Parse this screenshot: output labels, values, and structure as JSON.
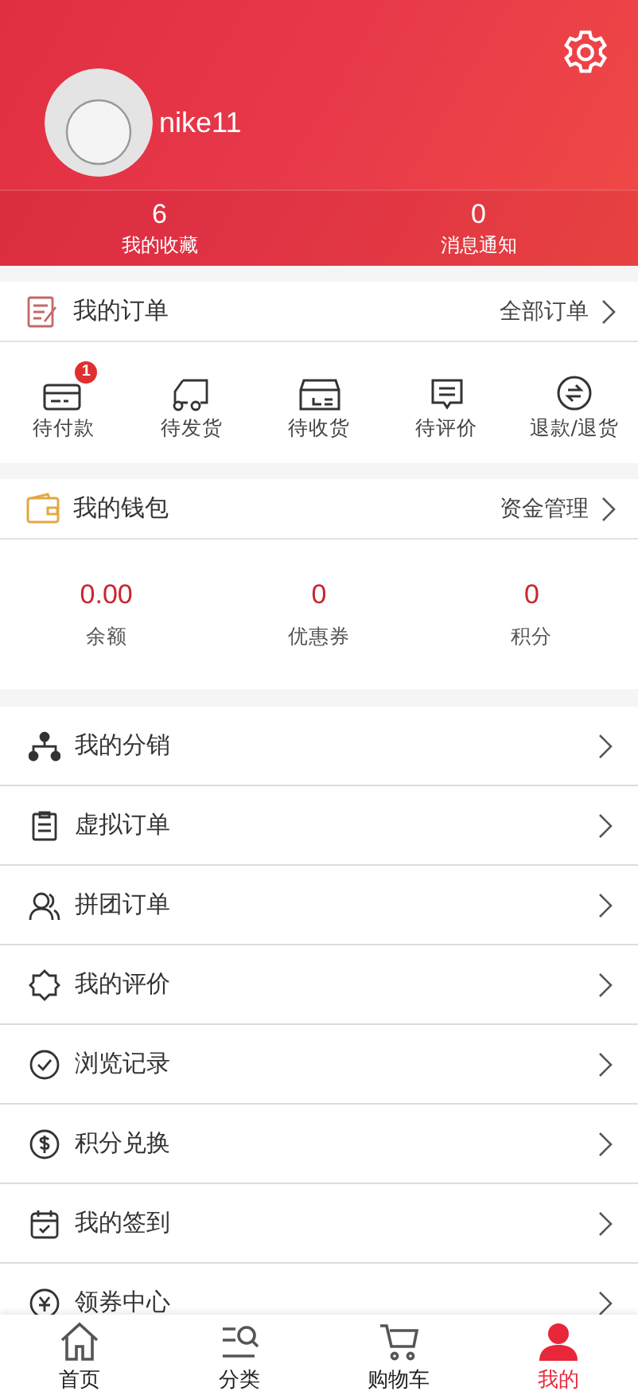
{
  "profile": {
    "username": "nike11",
    "stats": [
      {
        "value": "6",
        "label": "我的收藏"
      },
      {
        "value": "0",
        "label": "消息通知"
      }
    ]
  },
  "orders": {
    "title": "我的订单",
    "link": "全部订单",
    "statuses": [
      {
        "kind": "payment",
        "label": "待付款",
        "badge": "1"
      },
      {
        "kind": "ship",
        "label": "待发货"
      },
      {
        "kind": "receive",
        "label": "待收货"
      },
      {
        "kind": "review",
        "label": "待评价"
      },
      {
        "kind": "refund",
        "label": "退款/退货"
      }
    ]
  },
  "wallet": {
    "title": "我的钱包",
    "link": "资金管理",
    "items": [
      {
        "value": "0.00",
        "label": "余额"
      },
      {
        "value": "0",
        "label": "优惠券"
      },
      {
        "value": "0",
        "label": "积分"
      }
    ]
  },
  "menu": [
    {
      "kind": "distribution",
      "label": "我的分销"
    },
    {
      "kind": "virtual",
      "label": "虚拟订单"
    },
    {
      "kind": "group",
      "label": "拼团订单"
    },
    {
      "kind": "review",
      "label": "我的评价"
    },
    {
      "kind": "history",
      "label": "浏览记录"
    },
    {
      "kind": "points",
      "label": "积分兑换"
    },
    {
      "kind": "signin",
      "label": "我的签到"
    },
    {
      "kind": "coupon",
      "label": "领券中心"
    }
  ],
  "tabbar": [
    {
      "kind": "home",
      "label": "首页",
      "selected": false
    },
    {
      "kind": "category",
      "label": "分类",
      "selected": false
    },
    {
      "kind": "cart",
      "label": "购物车",
      "selected": false
    },
    {
      "kind": "me",
      "label": "我的",
      "selected": true
    }
  ]
}
